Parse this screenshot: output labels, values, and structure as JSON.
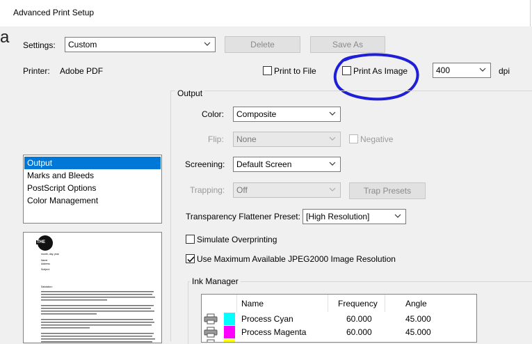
{
  "window": {
    "title": "Advanced Print Setup",
    "left_fragment": "a"
  },
  "settings": {
    "label": "Settings:",
    "value": "Custom",
    "delete_label": "Delete",
    "save_as_label": "Save As"
  },
  "printer": {
    "label": "Printer:",
    "name": "Adobe PDF",
    "print_to_file_label": "Print to File",
    "print_as_image_label": "Print As Image",
    "dpi_value": "400",
    "dpi_unit": "dpi"
  },
  "categories": {
    "items": [
      "Output",
      "Marks and Bleeds",
      "PostScript Options",
      "Color Management"
    ],
    "selected": "Output"
  },
  "preview_doc": {
    "logo": "THE",
    "date_line": "month, day, year",
    "name_line": "Name",
    "address_line": "Address",
    "subject_line": "Subject:",
    "salutation": "Salutation:"
  },
  "output": {
    "group_label": "Output",
    "color_label": "Color:",
    "color_value": "Composite",
    "flip_label": "Flip:",
    "flip_value": "None",
    "negative_label": "Negative",
    "screening_label": "Screening:",
    "screening_value": "Default Screen",
    "trapping_label": "Trapping:",
    "trapping_value": "Off",
    "trap_presets_label": "Trap Presets",
    "flattener_label": "Transparency Flattener Preset:",
    "flattener_value": "[High Resolution]",
    "simulate_label": "Simulate Overprinting",
    "jpeg_label": "Use Maximum Available JPEG2000 Image Resolution",
    "jpeg_checked": true
  },
  "ink_manager": {
    "label": "Ink Manager",
    "columns": [
      "Name",
      "Frequency",
      "Angle"
    ],
    "rows": [
      {
        "name": "Process Cyan",
        "frequency": "60.000",
        "angle": "45.000",
        "color": "#00ffff"
      },
      {
        "name": "Process Magenta",
        "frequency": "60.000",
        "angle": "45.000",
        "color": "#ff00ff"
      },
      {
        "name": "",
        "frequency": "",
        "angle": "",
        "color": "#ffff00"
      }
    ]
  },
  "colors": {
    "accent": "#0078d7",
    "annotation": "#1f1fd6"
  },
  "icons": {
    "dropdown": "chevron-down-icon",
    "printer": "printer-icon"
  }
}
